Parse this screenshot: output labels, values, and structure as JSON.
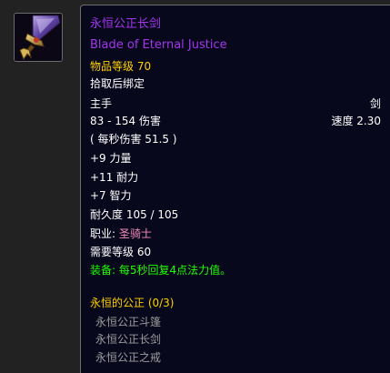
{
  "item": {
    "name_cn": "永恒公正长剑",
    "name_en": "Blade of Eternal Justice",
    "item_level": "物品等级 70",
    "binding": "拾取后绑定",
    "slot": "主手",
    "weapon_type": "剑",
    "damage": "83 - 154 伤害",
    "speed": "速度 2.30",
    "dps": "( 每秒伤害 51.5 )",
    "stats": [
      "+9 力量",
      "+11 耐力",
      "+7 智力"
    ],
    "durability": "耐久度 105 / 105",
    "class_label": "职业:",
    "class_value": "圣骑士",
    "required_level": "需要等级 60",
    "equip_effect": "装备: 每5秒回复4点法力值。"
  },
  "set": {
    "title": "永恒的公正 (0/3)",
    "pieces": [
      "永恒公正斗篷",
      "永恒公正长剑",
      "永恒公正之戒"
    ]
  },
  "colors": {
    "epic": "#a335ee",
    "gold": "#ffd100",
    "paladin": "#f58cba",
    "equip_green": "#1eff00",
    "set_missing": "#9d9d9d",
    "tooltip_bg": "#08081c"
  },
  "icon": "blade-of-eternal-justice-sword-icon"
}
